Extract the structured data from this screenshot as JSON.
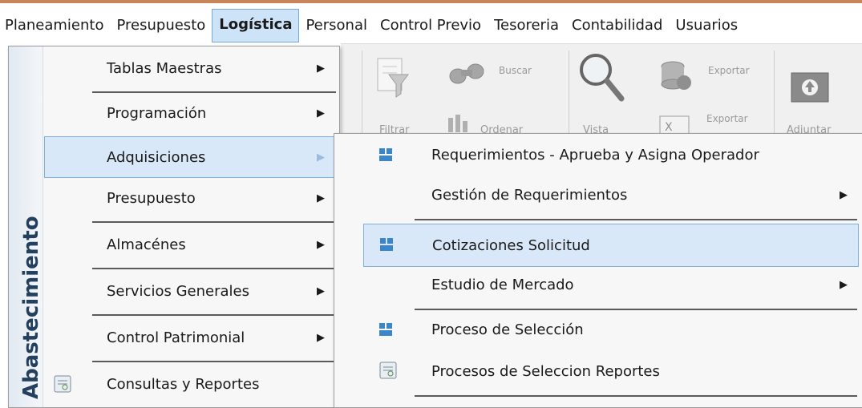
{
  "menubar": {
    "items": [
      {
        "label": "Planeamiento"
      },
      {
        "label": "Presupuesto"
      },
      {
        "label": "Logística",
        "active": true
      },
      {
        "label": "Personal"
      },
      {
        "label": "Control Previo"
      },
      {
        "label": "Tesoreria"
      },
      {
        "label": "Contabilidad"
      },
      {
        "label": "Usuarios"
      }
    ]
  },
  "toolbar": {
    "buscar": "Buscar",
    "ordenar": "Ordenar",
    "filtrar": "Filtrar",
    "vista": "Vista",
    "exportar1": "Exportar",
    "exportar2": "Exportar",
    "adjuntar": "Adjuntar"
  },
  "dropdown": {
    "side_title": "Abastecimiento",
    "items": [
      {
        "label": "Tablas Maestras",
        "has_submenu": true
      },
      {
        "label": "Programación",
        "has_submenu": true
      },
      {
        "label": "Adquisiciones",
        "has_submenu": true,
        "highlighted": true
      },
      {
        "label": "Presupuesto",
        "has_submenu": true
      },
      {
        "label": "Almacénes",
        "has_submenu": true
      },
      {
        "label": "Servicios Generales",
        "has_submenu": true
      },
      {
        "label": "Control Patrimonial",
        "has_submenu": true
      },
      {
        "label": "Consultas y Reportes",
        "has_submenu": false,
        "icon": "report-icon"
      }
    ]
  },
  "submenu": {
    "items": [
      {
        "label": "Requerimientos - Aprueba y Asigna Operador",
        "icon": "module-icon"
      },
      {
        "label": "Gestión de Requerimientos",
        "has_submenu": true
      },
      {
        "label": "Cotizaciones Solicitud",
        "icon": "module-icon",
        "highlighted": true
      },
      {
        "label": "Estudio de Mercado",
        "has_submenu": true
      },
      {
        "label": "Proceso de Selección",
        "icon": "module-icon"
      },
      {
        "label": "Procesos de Seleccion Reportes",
        "icon": "report-icon"
      }
    ]
  },
  "colors": {
    "accent_line": "#c9855a",
    "highlight_bg": "#d8e8f8",
    "highlight_border": "#7fb0dd",
    "side_title": "#24405f",
    "module_icon": "#3b86c9"
  }
}
